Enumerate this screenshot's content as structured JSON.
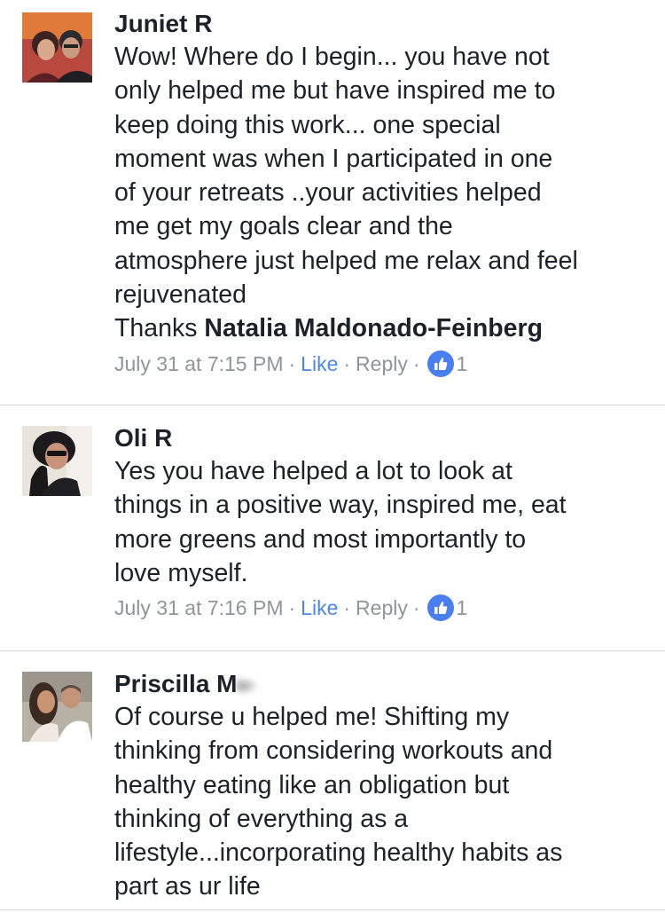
{
  "comments": [
    {
      "author": "Juniet R",
      "body_lines": [
        "Wow! Where do I begin... you have not",
        "only helped me but have inspired me to",
        "keep doing this work... one special",
        "moment was when I participated in one",
        "of your retreats ..your activities helped",
        "me get my goals clear and the",
        "atmosphere just helped me relax and feel",
        "rejuvenated"
      ],
      "thanks_prefix": "Thanks ",
      "mention": "Natalia Maldonado-Feinberg",
      "timestamp": "July 31 at 7:15 PM",
      "like_label": "Like",
      "reply_label": "Reply",
      "reaction_count": "1"
    },
    {
      "author": "Oli R",
      "body_lines": [
        "Yes you have helped a lot to look at",
        "things in a positive way, inspired me, eat",
        "more greens and most importantly to",
        "love myself."
      ],
      "timestamp": "July 31 at 7:16 PM",
      "like_label": "Like",
      "reply_label": "Reply",
      "reaction_count": "1"
    },
    {
      "author": "Priscilla M",
      "body_lines": [
        "Of course u helped me! Shifting my",
        "thinking from considering workouts and",
        "healthy eating like an obligation but",
        "thinking of everything as a",
        "lifestyle...incorporating healthy habits as",
        "part as ur life"
      ]
    }
  ],
  "separator": "·",
  "colors": {
    "text": "#1d2129",
    "meta": "#90949c",
    "like_link": "#4b88e5",
    "reaction_badge": "#4a7ff2",
    "divider": "#d8dade"
  },
  "icons": {
    "reaction": "thumbs-up-icon"
  }
}
